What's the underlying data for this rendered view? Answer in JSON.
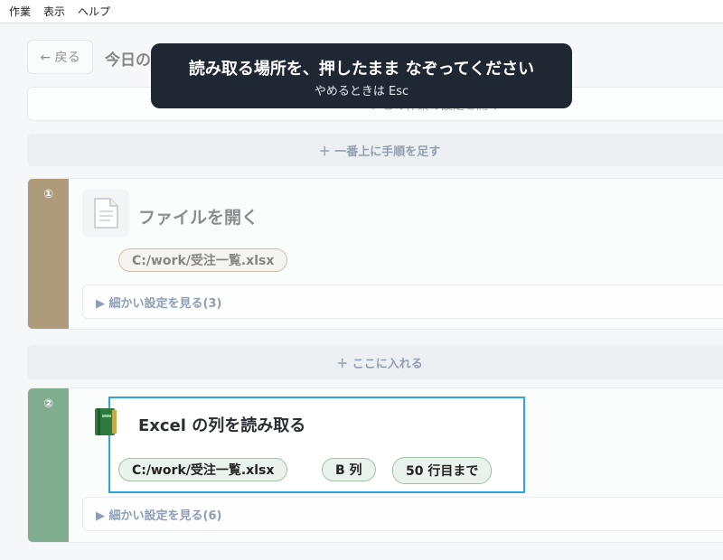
{
  "menubar": {
    "items": [
      "作業",
      "表示",
      "ヘルプ"
    ]
  },
  "header": {
    "back_label": "← 戻る",
    "title": "今日の記録",
    "settings_label": "⚙ この作業の設定を開く"
  },
  "add_step_top_label": "＋ 一番上に手順を足す",
  "insert_here_label": "＋ ここに入れる",
  "steps": [
    {
      "number": "①",
      "icon": "document-icon",
      "color": "#6b4a12",
      "title": "ファイルを開く",
      "chips": [
        "C:/work/受注一覧.xlsx"
      ],
      "details_label": "▶ 細かい設定を見る(3)"
    },
    {
      "number": "②",
      "icon": "excel-book-icon",
      "color": "#196b35",
      "title": "Excel の列を読み取る",
      "chips": [
        "C:/work/受注一覧.xlsx",
        "B 列",
        "50 行目まで"
      ],
      "details_label": "▶ 細かい設定を見る(6)"
    }
  ],
  "tooltip": {
    "main": "読み取る場所を、押したまま なぞってください",
    "sub": "やめるときは Esc"
  }
}
